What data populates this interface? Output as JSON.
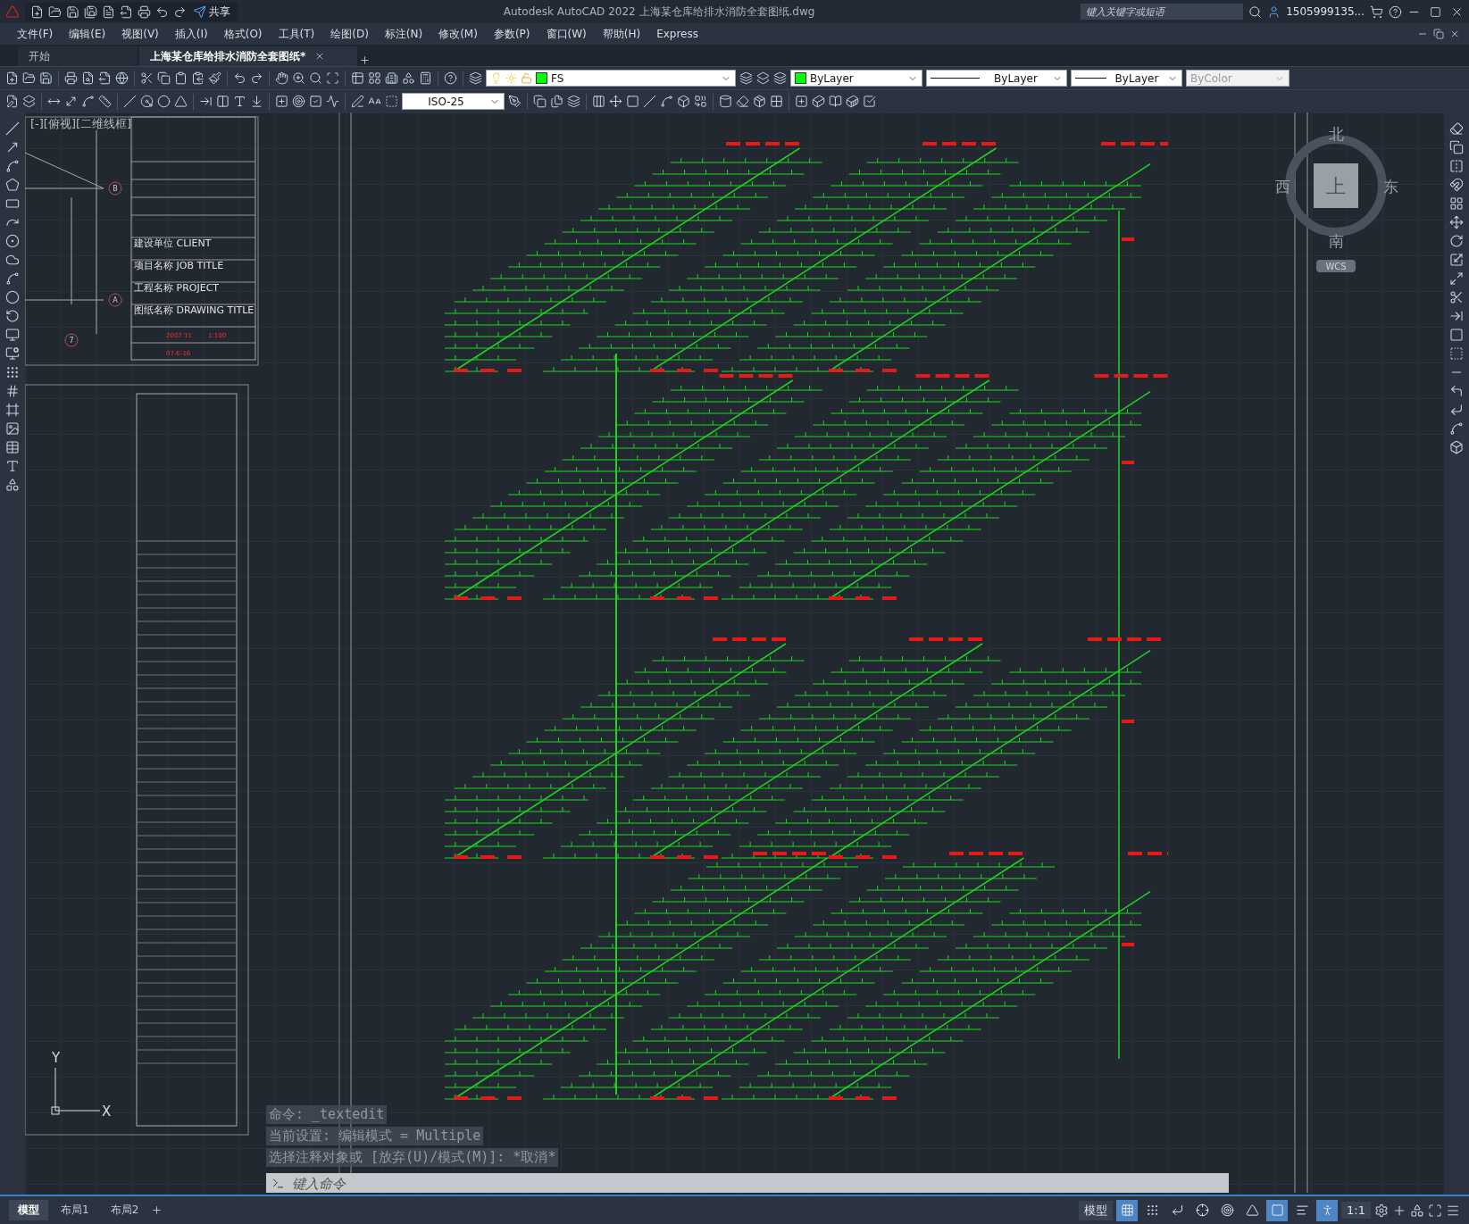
{
  "title_bar": {
    "share": "共享",
    "title": "Autodesk AutoCAD 2022    上海某仓库给排水消防全套图纸.dwg",
    "search": {
      "placeholder": "键入关键字或短语"
    },
    "user": "1505999135..."
  },
  "menu_bar": [
    "文件(F)",
    "编辑(E)",
    "视图(V)",
    "插入(I)",
    "格式(O)",
    "工具(T)",
    "绘图(D)",
    "标注(N)",
    "修改(M)",
    "参数(P)",
    "窗口(W)",
    "帮助(H)",
    "Express"
  ],
  "file_tabs": [
    {
      "label": "开始",
      "selected": false
    },
    {
      "label": "上海某仓库给排水消防全套图纸*",
      "selected": true
    }
  ],
  "properties": {
    "layer": {
      "value": "FS",
      "color": "#00ff00"
    },
    "color": {
      "value": "ByLayer",
      "color": "#00ff00"
    },
    "linetype": {
      "value": "ByLayer"
    },
    "lineweight": {
      "value": "ByLayer"
    },
    "plot_style": {
      "value": "ByColor",
      "disabled": true
    }
  },
  "dim_style": "ISO-25",
  "viewport": {
    "label": "[-][俯视][二维线框]",
    "title_block": {
      "texts": [
        "建设单位 CLIENT",
        "项目名称 JOB TITLE",
        "工程名称 PROJECT",
        "图纸名称 DRAWING TITLE",
        "2007.11",
        "1:100",
        "07-E-16"
      ],
      "axes": [
        "B",
        "A",
        "7"
      ]
    },
    "viewcube": {
      "north": "北",
      "south": "南",
      "east": "东",
      "west": "西",
      "face": "上",
      "ucs": "WCS"
    },
    "ucs_icon": {
      "x": "X",
      "y": "Y"
    },
    "command_history": [
      "命令: _textedit",
      "当前设置: 编辑模式 = Multiple",
      "选择注释对象或 [放弃(U)/模式(M)]: *取消*"
    ],
    "command_input": {
      "placeholder": "键入命令"
    }
  },
  "layout_tabs": [
    {
      "label": "模型",
      "selected": true
    },
    {
      "label": "布局1",
      "selected": false
    },
    {
      "label": "布局2",
      "selected": false
    }
  ],
  "status_bar": {
    "space": "模型",
    "scale": "1:1",
    "toggles": [
      {
        "kind": "grid",
        "on": true
      },
      {
        "kind": "snap",
        "on": false
      },
      {
        "kind": "ortho",
        "on": false
      },
      {
        "kind": "polar",
        "on": false
      },
      {
        "kind": "osnap",
        "on": false
      },
      {
        "kind": "angle",
        "on": false
      },
      {
        "kind": "selection",
        "on": true
      },
      {
        "kind": "lineweight",
        "on": false
      },
      {
        "kind": "annotation",
        "on": true
      }
    ]
  }
}
